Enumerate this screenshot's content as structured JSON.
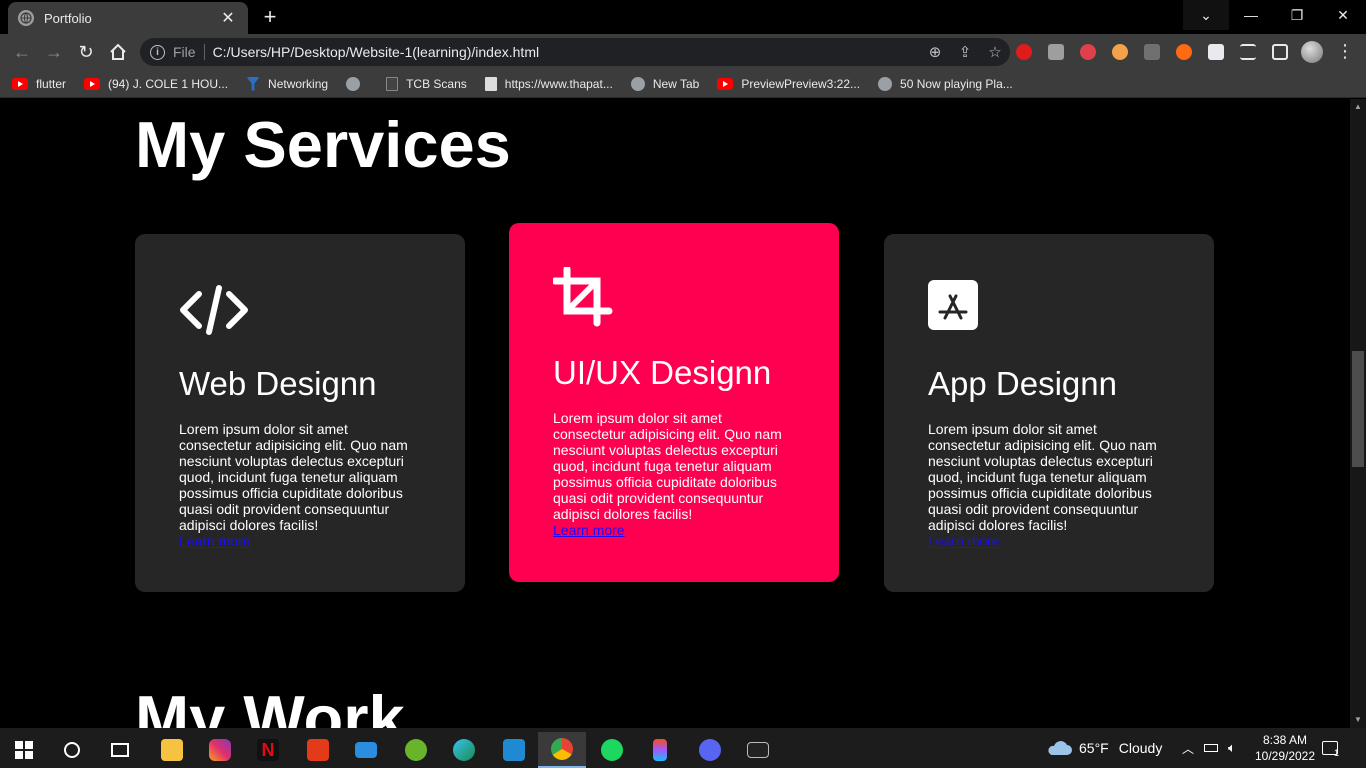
{
  "browser": {
    "tab_title": "Portfolio",
    "scheme_label": "File",
    "url": "C:/Users/HP/Desktop/Website-1(learning)/index.html",
    "bookmarks": [
      {
        "label": "flutter",
        "icon": "youtube-icon"
      },
      {
        "label": "(94) J. COLE 1 HOU...",
        "icon": "youtube-icon"
      },
      {
        "label": "Networking",
        "icon": "network-icon"
      },
      {
        "label": "",
        "icon": "globe-icon"
      },
      {
        "label": "TCB Scans",
        "icon": "page-icon"
      },
      {
        "label": "https://www.thapat...",
        "icon": "page-icon"
      },
      {
        "label": "New Tab",
        "icon": "globe-icon"
      },
      {
        "label": "PreviewPreview3:22...",
        "icon": "youtube-icon"
      },
      {
        "label": "50 Now playing Pla...",
        "icon": "globe-icon"
      }
    ]
  },
  "page": {
    "services_title": "My Services",
    "work_title": "My Work",
    "accent_color": "#ff0050",
    "card_color": "#262626",
    "cards": [
      {
        "icon": "code-icon",
        "title": "Web Designn",
        "text": "Lorem ipsum dolor sit amet consectetur adipisicing elit. Quo nam nesciunt voluptas delectus excepturi quod, incidunt fuga tenetur aliquam possimus officia cupiditate doloribus quasi odit provident consequuntur adipisci dolores facilis!",
        "link": "Learn more"
      },
      {
        "icon": "crop-icon",
        "title": "UI/UX Designn",
        "text": "Lorem ipsum dolor sit amet consectetur adipisicing elit. Quo nam nesciunt voluptas delectus excepturi quod, incidunt fuga tenetur aliquam possimus officia cupiditate doloribus quasi odit provident consequuntur adipisci dolores facilis!",
        "link": "Learn more"
      },
      {
        "icon": "app-store-icon",
        "title": "App Designn",
        "text": "Lorem ipsum dolor sit amet consectetur adipisicing elit. Quo nam nesciunt voluptas delectus excepturi quod, incidunt fuga tenetur aliquam possimus officia cupiditate doloribus quasi odit provident consequuntur adipisci dolores facilis!",
        "link": "Learn more"
      }
    ]
  },
  "taskbar": {
    "weather_temp": "65°F",
    "weather_text": "Cloudy",
    "time": "8:38 AM",
    "date": "10/29/2022",
    "notification_count": "1"
  }
}
